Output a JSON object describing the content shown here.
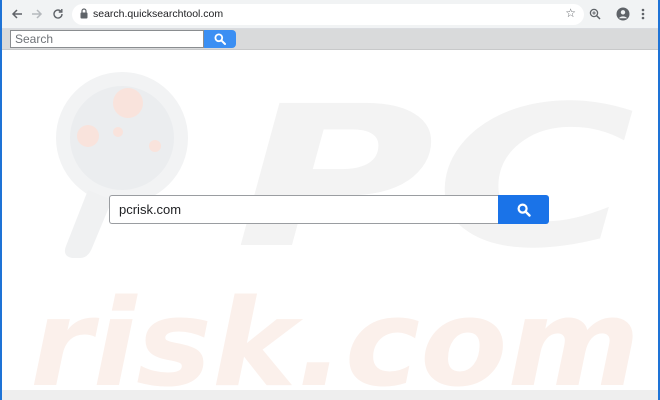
{
  "browser": {
    "url": "search.quicksearchtool.com",
    "icons": {
      "back": "arrow-left-icon",
      "forward": "arrow-right-icon",
      "reload": "reload-icon",
      "secure": "lock-icon",
      "bookmark": "star-icon",
      "zoom": "zoom-icon",
      "profile": "account-circle-icon",
      "menu": "kebab-menu-icon"
    }
  },
  "toolbar": {
    "search_placeholder": "Search",
    "search_icon": "search-icon"
  },
  "main": {
    "search_value": "pcrisk.com",
    "search_icon": "search-icon",
    "accent_color": "#1a73e8"
  },
  "watermark": {
    "line1": "PC",
    "line2": "risk.com"
  }
}
